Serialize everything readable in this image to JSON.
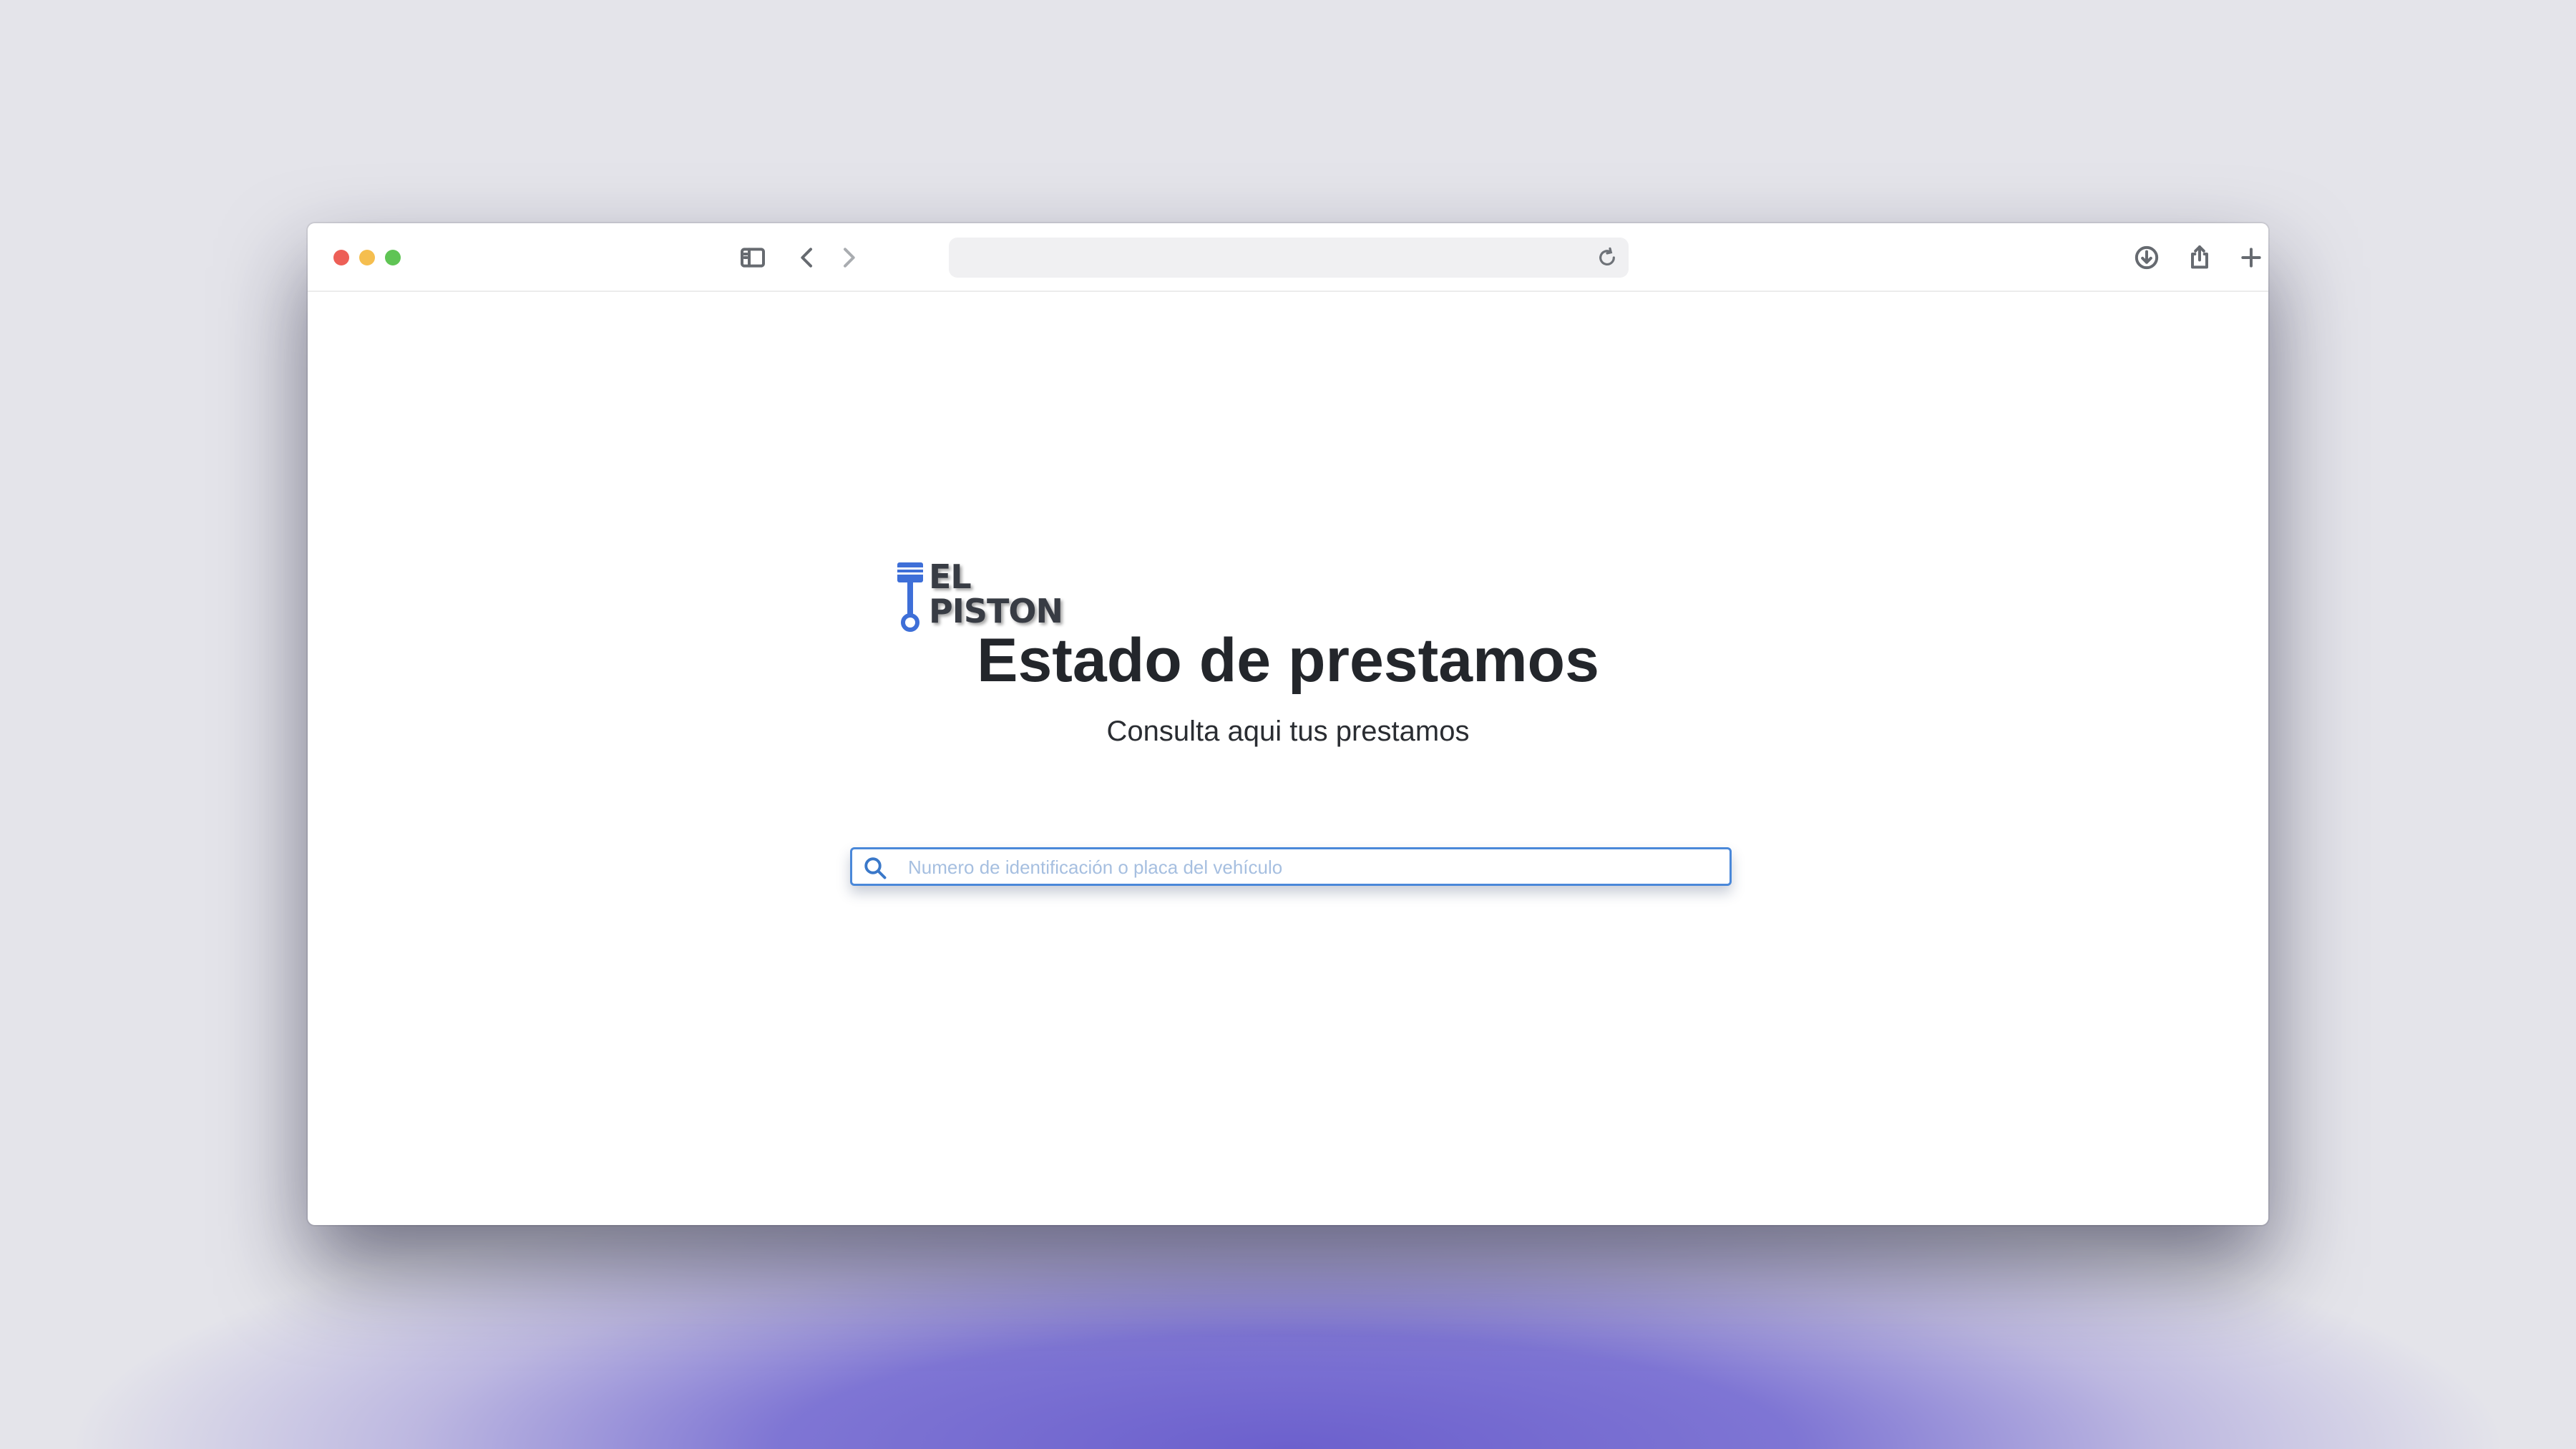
{
  "browser": {
    "address": "",
    "icons": {
      "sidebar": "sidebar-icon",
      "back": "chevron-left-icon",
      "forward": "chevron-right-icon",
      "privacy": "shield-icon",
      "reload": "reload-icon",
      "download": "download-icon",
      "share": "share-icon",
      "new_tab": "plus-icon",
      "tabs": "tab-overview-icon"
    }
  },
  "page": {
    "logo": {
      "line1": "EL",
      "line2": "PISTON",
      "mark": "piston-icon",
      "color": "#3e6fd8"
    },
    "title": "Estado de prestamos",
    "subtitle": "Consulta aqui tus prestamos",
    "search": {
      "placeholder": "Numero de identificación o placa del vehículo",
      "value": "",
      "icon": "search-icon"
    }
  }
}
